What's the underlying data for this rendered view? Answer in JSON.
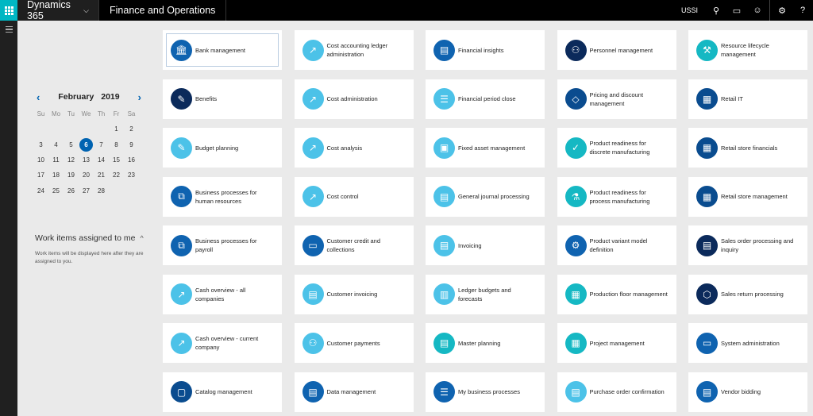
{
  "topbar": {
    "waffle_icon": "app-launcher-icon",
    "brand": "Dynamics 365",
    "brand_chevron": "⌵",
    "app_name": "Finance and Operations",
    "company": "USSI",
    "icons": {
      "search": "⚲",
      "messages": "▭",
      "feedback": "☺",
      "settings": "⚙",
      "help": "?"
    }
  },
  "calendar": {
    "prev": "‹",
    "next": "›",
    "month": "February",
    "year": "2019",
    "weekdays": [
      "Su",
      "Mo",
      "Tu",
      "We",
      "Th",
      "Fr",
      "Sa"
    ],
    "leading_blanks": 5,
    "days": [
      "1",
      "2",
      "3",
      "4",
      "5",
      "6",
      "7",
      "8",
      "9",
      "10",
      "11",
      "12",
      "13",
      "14",
      "15",
      "16",
      "17",
      "18",
      "19",
      "20",
      "21",
      "22",
      "23",
      "24",
      "25",
      "26",
      "27",
      "28"
    ],
    "selected_day": "6"
  },
  "work_items": {
    "title": "Work items assigned to me",
    "collapse_icon": "^",
    "empty_message": "Work items will be displayed here after they are assigned to you."
  },
  "tiles": [
    {
      "label": "Bank management",
      "color": "blue",
      "glyph": "🏛",
      "focused": true
    },
    {
      "label": "Cost accounting ledger administration",
      "color": "lightblue",
      "glyph": "↗"
    },
    {
      "label": "Financial insights",
      "color": "blue",
      "glyph": "▤"
    },
    {
      "label": "Personnel management",
      "color": "navy",
      "glyph": "⚇"
    },
    {
      "label": "Resource lifecycle management",
      "color": "teal",
      "glyph": "⚒"
    },
    {
      "label": "Benefits",
      "color": "navy",
      "glyph": "✎"
    },
    {
      "label": "Cost administration",
      "color": "lightblue",
      "glyph": "↗"
    },
    {
      "label": "Financial period close",
      "color": "lightblue",
      "glyph": "☰"
    },
    {
      "label": "Pricing and discount management",
      "color": "darkblue",
      "glyph": "◇"
    },
    {
      "label": "Retail IT",
      "color": "darkblue",
      "glyph": "▦"
    },
    {
      "label": "Budget planning",
      "color": "lightblue",
      "glyph": "✎"
    },
    {
      "label": "Cost analysis",
      "color": "lightblue",
      "glyph": "↗"
    },
    {
      "label": "Fixed asset management",
      "color": "lightblue",
      "glyph": "▣"
    },
    {
      "label": "Product readiness for discrete manufacturing",
      "color": "teal",
      "glyph": "✓"
    },
    {
      "label": "Retail store financials",
      "color": "darkblue",
      "glyph": "▦"
    },
    {
      "label": "Business processes for human resources",
      "color": "blue",
      "glyph": "⧉"
    },
    {
      "label": "Cost control",
      "color": "lightblue",
      "glyph": "↗"
    },
    {
      "label": "General journal processing",
      "color": "lightblue",
      "glyph": "▤"
    },
    {
      "label": "Product readiness for process manufacturing",
      "color": "teal",
      "glyph": "⚗"
    },
    {
      "label": "Retail store management",
      "color": "darkblue",
      "glyph": "▦"
    },
    {
      "label": "Business processes for payroll",
      "color": "blue",
      "glyph": "⧉"
    },
    {
      "label": "Customer credit and collections",
      "color": "blue",
      "glyph": "▭"
    },
    {
      "label": "Invoicing",
      "color": "lightblue",
      "glyph": "▤"
    },
    {
      "label": "Product variant model definition",
      "color": "blue",
      "glyph": "⚙"
    },
    {
      "label": "Sales order processing and inquiry",
      "color": "navy",
      "glyph": "▤"
    },
    {
      "label": "Cash overview - all companies",
      "color": "lightblue",
      "glyph": "↗"
    },
    {
      "label": "Customer invoicing",
      "color": "lightblue",
      "glyph": "▤"
    },
    {
      "label": "Ledger budgets and forecasts",
      "color": "lightblue",
      "glyph": "▥"
    },
    {
      "label": "Production floor management",
      "color": "teal",
      "glyph": "▦"
    },
    {
      "label": "Sales return processing",
      "color": "navy",
      "glyph": "⬡"
    },
    {
      "label": "Cash overview - current company",
      "color": "lightblue",
      "glyph": "↗"
    },
    {
      "label": "Customer payments",
      "color": "lightblue",
      "glyph": "⚇"
    },
    {
      "label": "Master planning",
      "color": "teal",
      "glyph": "▤"
    },
    {
      "label": "Project management",
      "color": "teal",
      "glyph": "▦"
    },
    {
      "label": "System administration",
      "color": "blue",
      "glyph": "▭"
    },
    {
      "label": "Catalog management",
      "color": "darkblue",
      "glyph": "▢"
    },
    {
      "label": "Data management",
      "color": "blue",
      "glyph": "▤"
    },
    {
      "label": "My business processes",
      "color": "blue",
      "glyph": "☰"
    },
    {
      "label": "Purchase order confirmation",
      "color": "lightblue",
      "glyph": "▤"
    },
    {
      "label": "Vendor bidding",
      "color": "blue",
      "glyph": "▤"
    }
  ],
  "colors": {
    "accent": "#0063b1",
    "waffle": "#00b7c3",
    "blue": "#0f63b0",
    "navy": "#0b2a5b",
    "lightblue": "#4cc2e8",
    "teal": "#15b8c3",
    "darkblue": "#0a4c8f"
  }
}
